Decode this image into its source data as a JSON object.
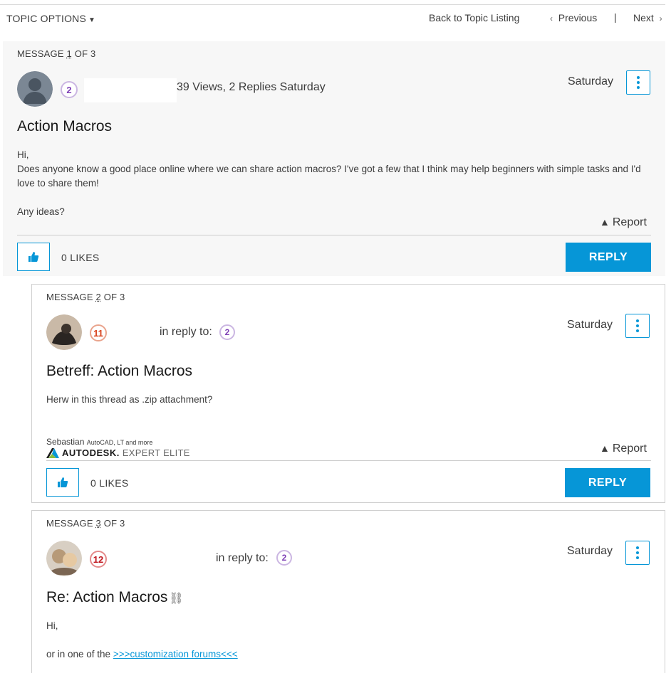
{
  "topbar": {
    "topic_options": "TOPIC OPTIONS",
    "back": "Back to Topic Listing",
    "previous": "Previous",
    "separator": "|",
    "next": "Next"
  },
  "messages": [
    {
      "counter_prefix": "MESSAGE ",
      "counter_num": "1",
      "counter_suffix": " OF 3",
      "rank": "2",
      "views": "39 Views, 2 Replies Saturday",
      "date": "Saturday",
      "subject": "Action Macros",
      "body": [
        "Hi,",
        "Does anyone know a good place online where we can share action macros? I've got a few that I think may help beginners with simple tasks and I'd love to share them!",
        "",
        "Any ideas?"
      ],
      "report": "Report",
      "likes": "0 LIKES",
      "reply": "REPLY"
    },
    {
      "counter_prefix": "MESSAGE ",
      "counter_num": "2",
      "counter_suffix": " OF 3",
      "rank": "11",
      "in_reply_to": "in reply to:",
      "reply_rank": "2",
      "date": "Saturday",
      "subject": "Betreff: Action Macros",
      "body": "Herw in this thread as .zip attachment?",
      "sig_name": "Sebastian",
      "sig_small": "AutoCAD, LT and more",
      "sig_brand": "AUTODESK.",
      "sig_title": "EXPERT ELITE",
      "report": "Report",
      "likes": "0 LIKES",
      "reply": "REPLY"
    },
    {
      "counter_prefix": "MESSAGE ",
      "counter_num": "3",
      "counter_suffix": " OF 3",
      "rank": "12",
      "in_reply_to": "in reply to:",
      "reply_rank": "2",
      "date": "Saturday",
      "subject": "Re: Action Macros",
      "body_1": "Hi,",
      "body_2_prefix": "or in one of the ",
      "body_2_link": ">>>customization forums<<<"
    }
  ],
  "colors": {
    "accent": "#0696d7",
    "rank_purple": "#7e3fb6",
    "rank_orange": "#d8431c",
    "rank_red": "#c0161d"
  }
}
